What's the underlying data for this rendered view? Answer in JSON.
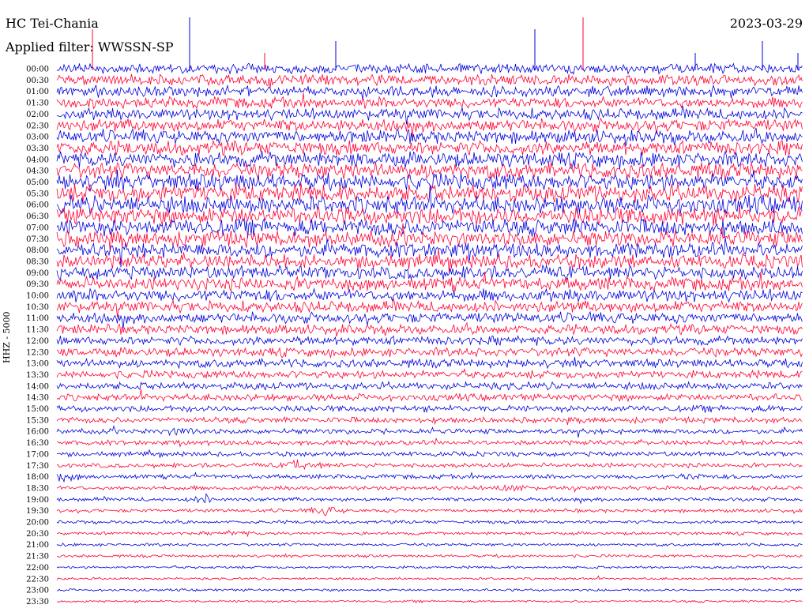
{
  "header": {
    "station": "HC Tei-Chania",
    "date": "2023-03-29",
    "filter": "Applied filter: WWSSN-SP"
  },
  "chart_data": {
    "type": "line",
    "channel_label": "HHZ - 5000",
    "rows": [
      "00:00",
      "00:30",
      "01:00",
      "01:30",
      "02:00",
      "02:30",
      "03:00",
      "03:30",
      "04:00",
      "04:30",
      "05:00",
      "05:30",
      "06:00",
      "06:30",
      "07:00",
      "07:30",
      "08:00",
      "08:30",
      "09:00",
      "09:30",
      "10:00",
      "10:30",
      "11:00",
      "11:30",
      "12:00",
      "12:30",
      "13:00",
      "13:30",
      "14:00",
      "14:30",
      "15:00",
      "15:30",
      "16:00",
      "16:30",
      "17:00",
      "17:30",
      "18:00",
      "18:30",
      "19:00",
      "19:30",
      "20:00",
      "20:30",
      "21:00",
      "21:30",
      "22:00",
      "22:30",
      "23:00",
      "23:30"
    ],
    "colors": [
      "#0000dd",
      "#ff0033"
    ],
    "relative_amplitude": [
      0.55,
      0.6,
      0.6,
      0.62,
      0.65,
      0.7,
      0.75,
      0.8,
      0.85,
      0.9,
      0.95,
      1.0,
      1.0,
      1.0,
      0.95,
      0.9,
      0.85,
      0.8,
      0.75,
      0.75,
      0.7,
      0.65,
      0.6,
      0.55,
      0.5,
      0.5,
      0.48,
      0.45,
      0.42,
      0.4,
      0.36,
      0.33,
      0.3,
      0.28,
      0.27,
      0.26,
      0.25,
      0.24,
      0.22,
      0.2,
      0.19,
      0.18,
      0.17,
      0.16,
      0.15,
      0.14,
      0.14,
      0.13
    ],
    "events": [
      {
        "row": "17:30",
        "time_fraction": 0.33,
        "strength": 2.2
      },
      {
        "row": "19:30",
        "time_fraction": 0.36,
        "strength": 2.0
      },
      {
        "row": "19:00",
        "time_fraction": 0.2,
        "strength": 1.6
      },
      {
        "row": "18:00",
        "time_fraction": 0.01,
        "strength": 1.4
      },
      {
        "row": "18:30",
        "time_fraction": 0.61,
        "strength": 1.3
      },
      {
        "row": "16:00",
        "time_fraction": 0.17,
        "strength": 1.2
      },
      {
        "row": "20:30",
        "time_fraction": 0.24,
        "strength": 1.1
      },
      {
        "row": "18:00",
        "time_fraction": 0.85,
        "strength": 1.0
      }
    ]
  }
}
